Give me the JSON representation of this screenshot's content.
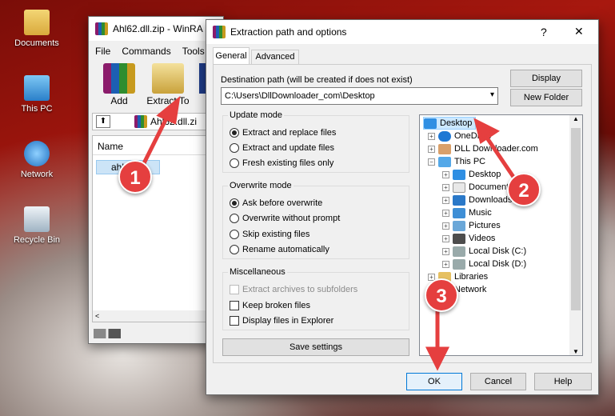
{
  "desktop": {
    "icons": [
      {
        "label": "Documents"
      },
      {
        "label": "This PC"
      },
      {
        "label": "Network"
      },
      {
        "label": "Recycle Bin"
      }
    ]
  },
  "winrar": {
    "title": "Ahl62.dll.zip - WinRA",
    "menu": [
      "File",
      "Commands",
      "Tools"
    ],
    "toolbar": {
      "add": "Add",
      "extract": "Extract To"
    },
    "address": "Ahl62.dll.zi",
    "column_name": "Name",
    "file": "ahl62.dll"
  },
  "dialog": {
    "title": "Extraction path and options",
    "help": "?",
    "close": "✕",
    "tabs": [
      "General",
      "Advanced"
    ],
    "dest_label": "Destination path (will be created if does not exist)",
    "dest_value": "C:\\Users\\DllDownloader_com\\Desktop",
    "display_btn": "Display",
    "newfolder_btn": "New Folder",
    "update_mode": {
      "label": "Update mode",
      "options": [
        "Extract and replace files",
        "Extract and update files",
        "Fresh existing files only"
      ]
    },
    "overwrite_mode": {
      "label": "Overwrite mode",
      "options": [
        "Ask before overwrite",
        "Overwrite without prompt",
        "Skip existing files",
        "Rename automatically"
      ]
    },
    "misc": {
      "label": "Miscellaneous",
      "options": [
        "Extract archives to subfolders",
        "Keep broken files",
        "Display files in Explorer"
      ]
    },
    "save_btn": "Save settings",
    "tree": [
      "Desktop",
      "OneDrive",
      "DLL Downloader.com",
      "This PC",
      "Desktop",
      "Documents",
      "Downloads",
      "Music",
      "Pictures",
      "Videos",
      "Local Disk (C:)",
      "Local Disk (D:)",
      "Libraries",
      "Network"
    ],
    "ok": "OK",
    "cancel": "Cancel",
    "help_btn": "Help"
  },
  "markers": [
    "1",
    "2",
    "3"
  ]
}
